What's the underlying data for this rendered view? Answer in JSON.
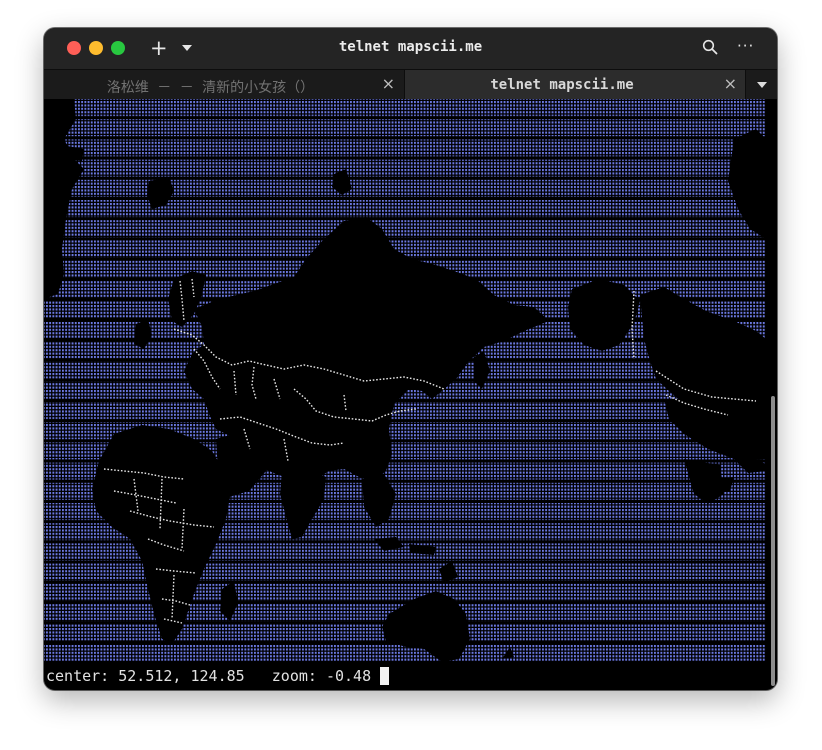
{
  "window": {
    "title": "telnet mapscii.me"
  },
  "toolbar": {
    "new_tab_label": "+",
    "more_label": "···"
  },
  "tabs": [
    {
      "label": "洛松维 －  － 清新的小女孩（）",
      "active": false,
      "close_label": "×"
    },
    {
      "label": "telnet mapscii.me",
      "active": true,
      "close_label": "×"
    }
  ],
  "map": {
    "ocean_color": "#6b78e0",
    "land_color": "#000000",
    "border_color": "#e8e8e8"
  },
  "status": {
    "center_label": "center:",
    "center_value": "52.512, 124.85",
    "zoom_label": "zoom:",
    "zoom_value": "-0.48"
  }
}
